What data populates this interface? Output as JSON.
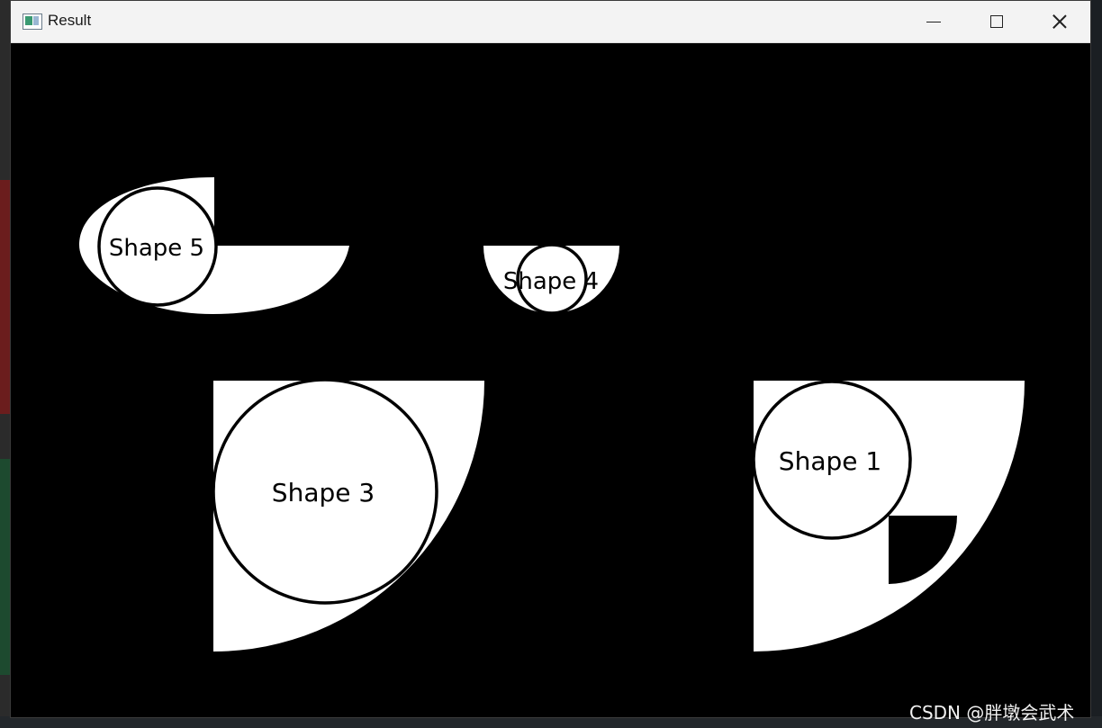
{
  "window": {
    "title": "Result"
  },
  "shapes": [
    {
      "label": "Shape 5"
    },
    {
      "label": "Shape 4"
    },
    {
      "label": "Shape 3"
    },
    {
      "label": "Shape 1"
    }
  ],
  "watermark": "CSDN @胖墩会武术",
  "colors": {
    "canvas_bg": "#000000",
    "shape_fill": "#ffffff",
    "outline": "#000000",
    "titlebar": "#f3f3f3"
  }
}
